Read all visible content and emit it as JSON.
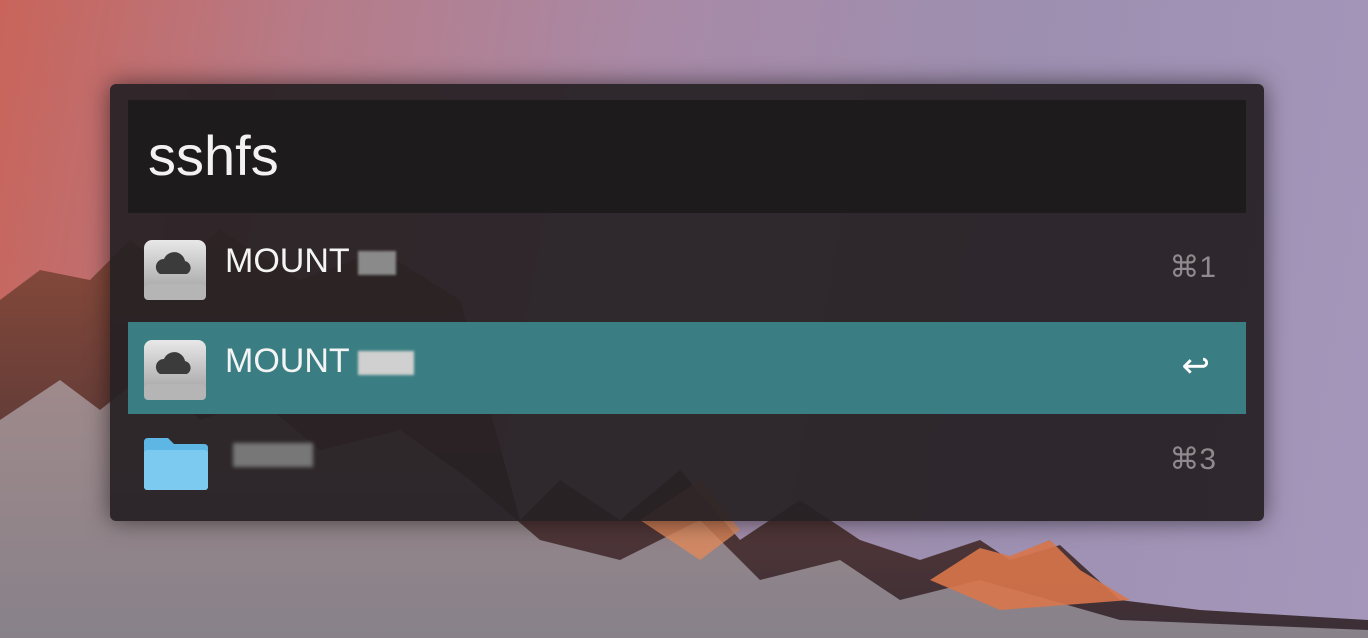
{
  "search": {
    "query": "sshfs"
  },
  "results": [
    {
      "title": "MOUNT",
      "subtitle": "",
      "shortcut": "⌘1",
      "icon": "cloud-drive-icon",
      "selected": false
    },
    {
      "title": "MOUNT",
      "subtitle": "",
      "shortcut": "↩",
      "icon": "cloud-drive-icon",
      "selected": true
    },
    {
      "title": "",
      "subtitle": "",
      "shortcut": "⌘3",
      "icon": "folder-icon",
      "selected": false
    }
  ],
  "colors": {
    "selected_row": "#3a7e83",
    "panel_bg": "#262024",
    "search_bg": "#1e1b1d"
  }
}
